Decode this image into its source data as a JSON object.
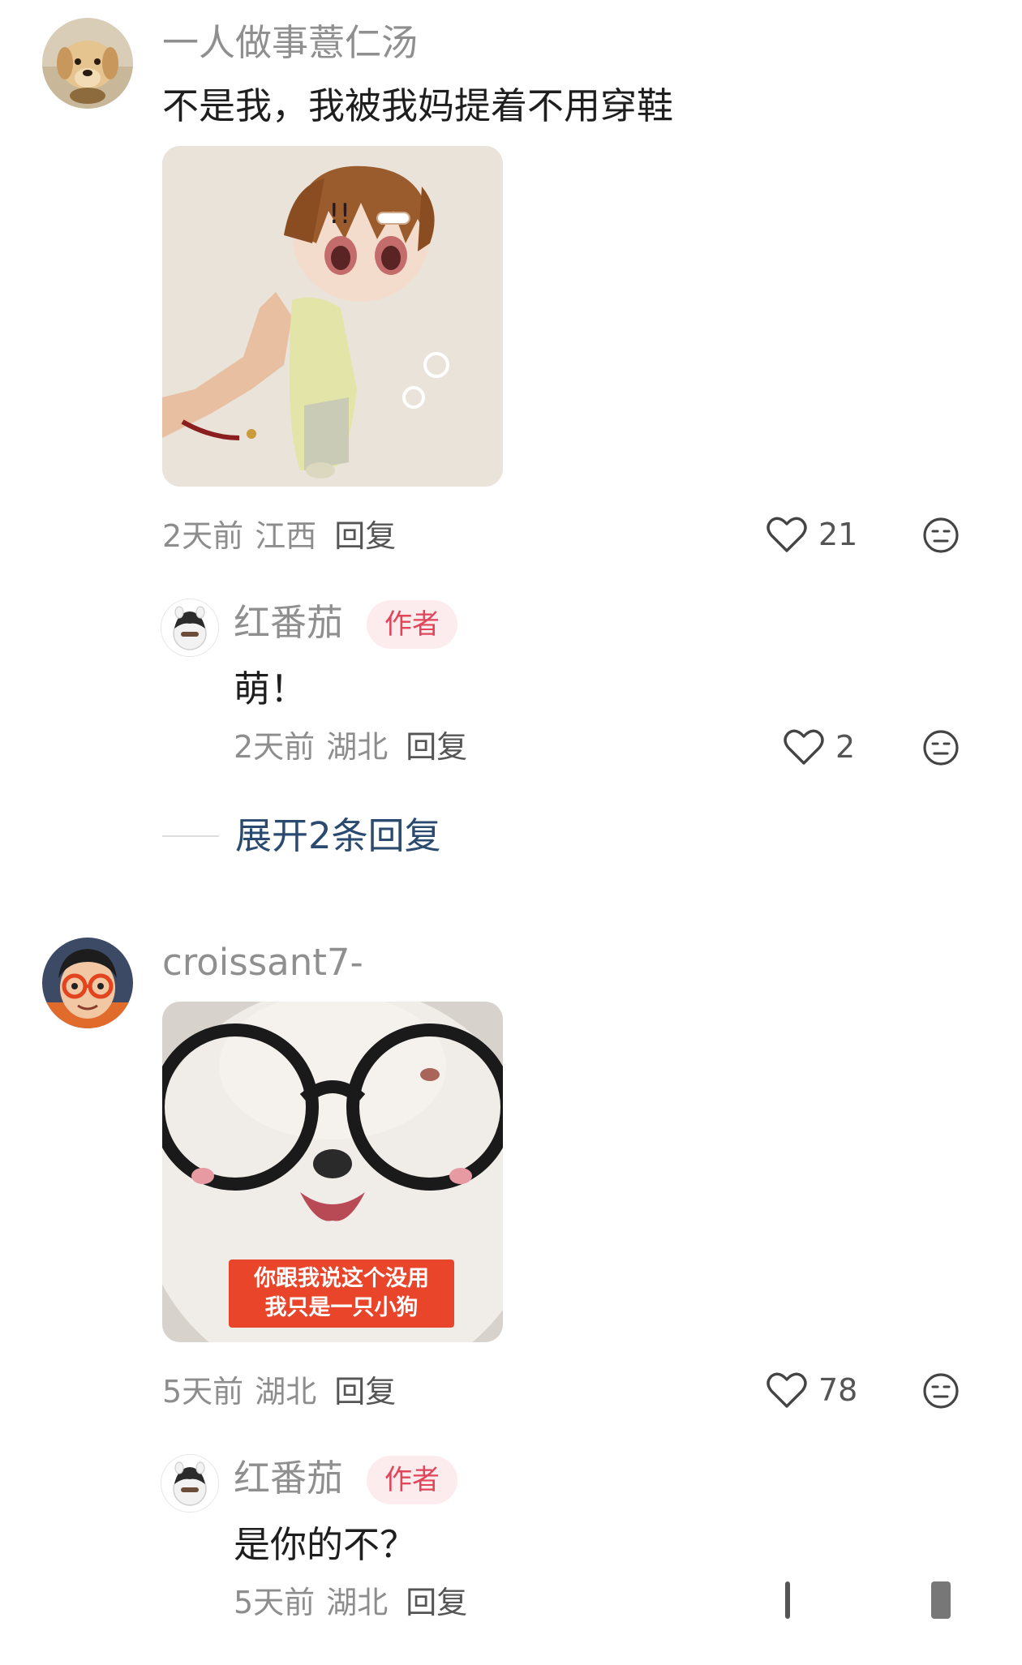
{
  "comments": [
    {
      "username": "一人做事薏仁汤",
      "text": "不是我，我被我妈提着不用穿鞋",
      "time": "2天前",
      "location": "江西",
      "reply_label": "回复",
      "likes": "21",
      "avatar": "golden-retriever-puppy",
      "photo": "anime-doll-held-in-hand",
      "replies": [
        {
          "username": "红番茄",
          "badge": "作者",
          "text": "萌！",
          "time": "2天前",
          "location": "湖北",
          "reply_label": "回复",
          "likes": "2"
        }
      ],
      "expand_label": "展开2条回复"
    },
    {
      "username": "croissant7-",
      "text": "",
      "time": "5天前",
      "location": "湖北",
      "reply_label": "回复",
      "likes": "78",
      "avatar": "person-with-red-glasses",
      "photo": "plush-dog-wearing-glasses",
      "photo_caption_line1": "你跟我说这个没用",
      "photo_caption_line2": "我只是一只小狗",
      "replies": [
        {
          "username": "红番茄",
          "badge": "作者",
          "text": "是你的不？",
          "time": "5天前",
          "location": "湖北",
          "reply_label": "回复"
        }
      ]
    }
  ],
  "colors": {
    "username": "#8f8f8f",
    "meta": "#8d8d8d",
    "badge_bg": "#fdecee",
    "badge_text": "#e0455a",
    "expand_link": "#2b4a6f",
    "caption_bg": "#e8452b"
  }
}
